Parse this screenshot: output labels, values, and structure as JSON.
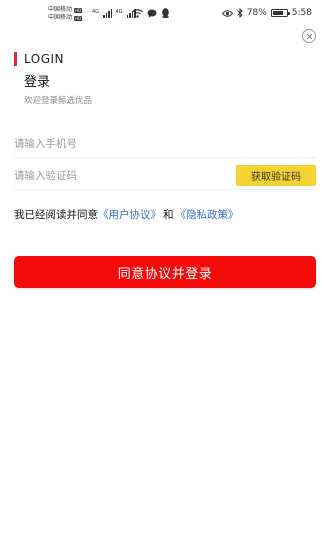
{
  "status_bar": {
    "carrier_1": "中国移动",
    "carrier_2": "中国移动",
    "carrier_tag": "HD",
    "net_1": "4G",
    "net_2": "4G",
    "battery_percent": "78%",
    "battery_level": 0.78,
    "time": "5:58",
    "icons": [
      "wifi-icon",
      "message-icon",
      "qq-icon",
      "eye-icon",
      "bluetooth-icon",
      "battery-icon"
    ]
  },
  "login": {
    "title_en": "LOGIN",
    "title_cn": "登录",
    "welcome": "欢迎登录鲸选优品",
    "accent_color": "#e52d27"
  },
  "form": {
    "phone_placeholder": "请输入手机号",
    "code_placeholder": "请输入验证码",
    "get_code_label": "获取验证码",
    "get_code_color": "#f3d332"
  },
  "agreement": {
    "prefix": "我已经阅读并同意",
    "user_agreement": "《用户协议》",
    "conjunction": "和",
    "privacy_policy": "《隐私政策》",
    "link_color": "#3a6fd0"
  },
  "submit": {
    "label": "同意协议并登录",
    "color": "#f50a0a"
  }
}
